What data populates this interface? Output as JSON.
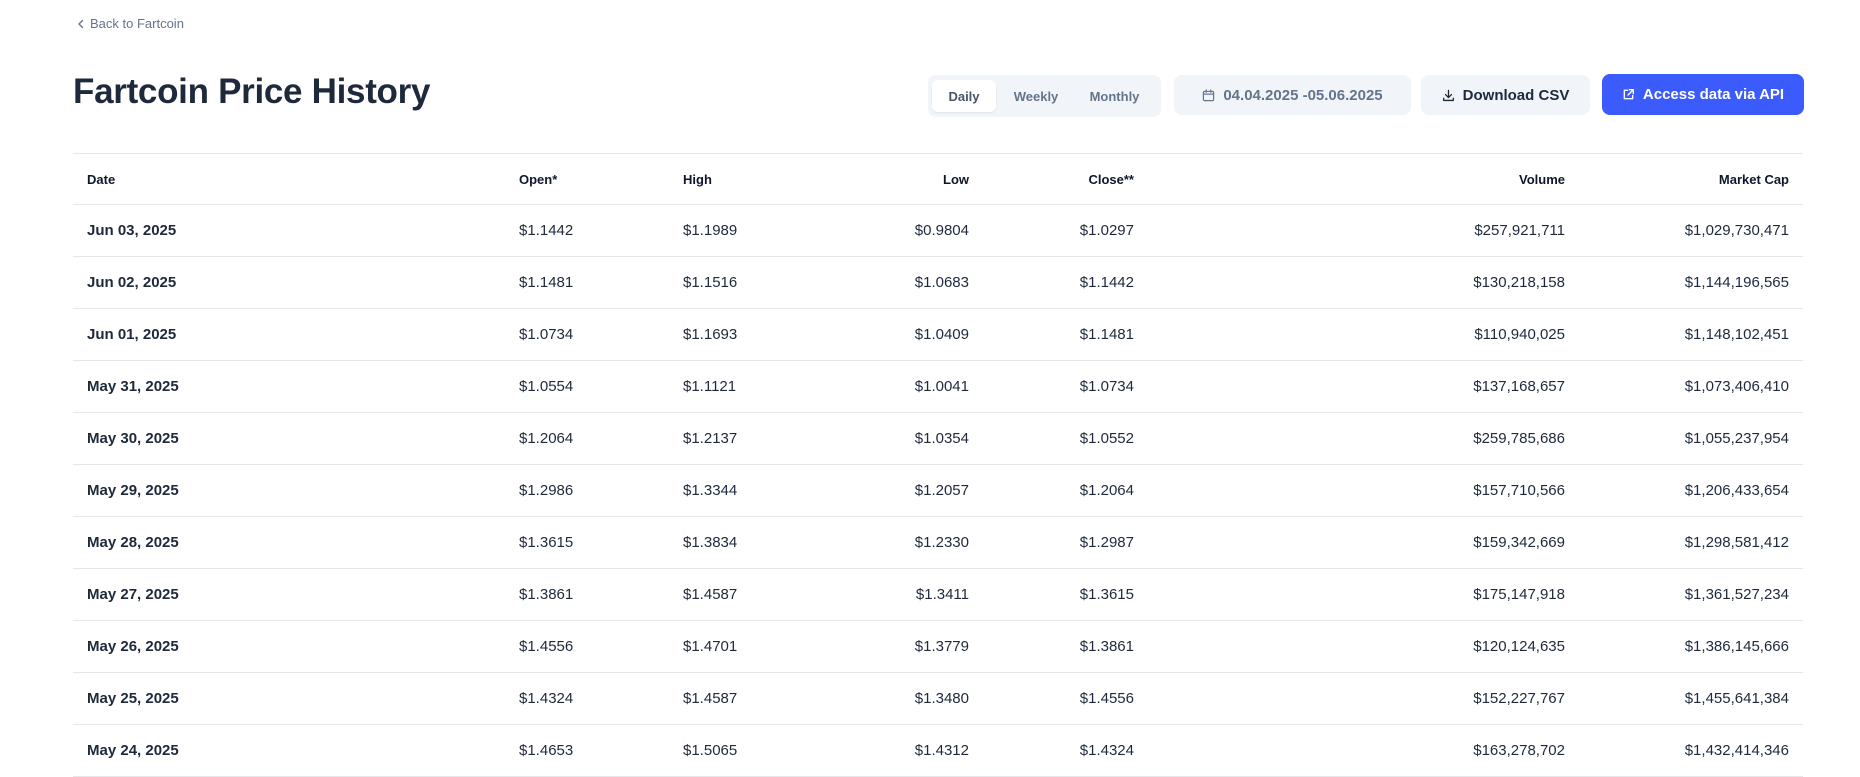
{
  "back_link": "Back to Fartcoin",
  "title": "Fartcoin Price History",
  "period_toggle": [
    {
      "label": "Daily",
      "active": true
    },
    {
      "label": "Weekly",
      "active": false
    },
    {
      "label": "Monthly",
      "active": false
    }
  ],
  "date_range": "04.04.2025 -05.06.2025",
  "download_label": "Download CSV",
  "api_label": "Access data via API",
  "colors": {
    "accent": "#3b5bfd",
    "button_bg": "#f1f5f9"
  },
  "table": {
    "columns": [
      "Date",
      "Open*",
      "High",
      "Low",
      "Close**",
      "Volume",
      "Market Cap"
    ],
    "rows": [
      [
        "Jun 03, 2025",
        "$1.1442",
        "$1.1989",
        "$0.9804",
        "$1.0297",
        "$257,921,711",
        "$1,029,730,471"
      ],
      [
        "Jun 02, 2025",
        "$1.1481",
        "$1.1516",
        "$1.0683",
        "$1.1442",
        "$130,218,158",
        "$1,144,196,565"
      ],
      [
        "Jun 01, 2025",
        "$1.0734",
        "$1.1693",
        "$1.0409",
        "$1.1481",
        "$110,940,025",
        "$1,148,102,451"
      ],
      [
        "May 31, 2025",
        "$1.0554",
        "$1.1121",
        "$1.0041",
        "$1.0734",
        "$137,168,657",
        "$1,073,406,410"
      ],
      [
        "May 30, 2025",
        "$1.2064",
        "$1.2137",
        "$1.0354",
        "$1.0552",
        "$259,785,686",
        "$1,055,237,954"
      ],
      [
        "May 29, 2025",
        "$1.2986",
        "$1.3344",
        "$1.2057",
        "$1.2064",
        "$157,710,566",
        "$1,206,433,654"
      ],
      [
        "May 28, 2025",
        "$1.3615",
        "$1.3834",
        "$1.2330",
        "$1.2987",
        "$159,342,669",
        "$1,298,581,412"
      ],
      [
        "May 27, 2025",
        "$1.3861",
        "$1.4587",
        "$1.3411",
        "$1.3615",
        "$175,147,918",
        "$1,361,527,234"
      ],
      [
        "May 26, 2025",
        "$1.4556",
        "$1.4701",
        "$1.3779",
        "$1.3861",
        "$120,124,635",
        "$1,386,145,666"
      ],
      [
        "May 25, 2025",
        "$1.4324",
        "$1.4587",
        "$1.3480",
        "$1.4556",
        "$152,227,767",
        "$1,455,641,384"
      ],
      [
        "May 24, 2025",
        "$1.4653",
        "$1.5065",
        "$1.4312",
        "$1.4324",
        "$163,278,702",
        "$1,432,414,346"
      ]
    ]
  }
}
